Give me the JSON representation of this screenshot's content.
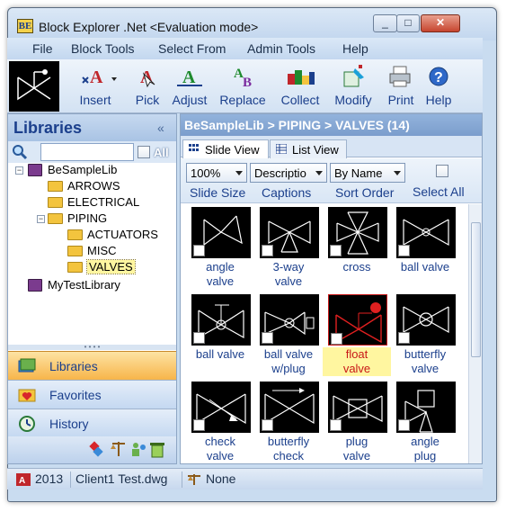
{
  "window": {
    "title": "Block Explorer .Net <Evaluation mode>",
    "app_icon_text": "BE"
  },
  "menu": [
    "File",
    "Block Tools",
    "Select From",
    "Admin Tools",
    "Help"
  ],
  "toolbar": {
    "tools": [
      {
        "label": "Insert",
        "icon": "insert-icon"
      },
      {
        "label": "Pick",
        "icon": "pick-icon"
      },
      {
        "label": "Adjust",
        "icon": "adjust-icon"
      },
      {
        "label": "Replace",
        "icon": "replace-icon"
      },
      {
        "label": "Collect",
        "icon": "collect-icon"
      },
      {
        "label": "Modify",
        "icon": "modify-icon"
      },
      {
        "label": "Print",
        "icon": "printer-icon"
      },
      {
        "label": "Help",
        "icon": "help-icon"
      }
    ]
  },
  "libraries": {
    "title": "Libraries",
    "collapse_glyph": "«",
    "search_all_label": "All",
    "tree": [
      {
        "label": "BeSampleLib",
        "type": "library",
        "level": 0,
        "expander": "⊟"
      },
      {
        "label": "ARROWS",
        "type": "folder",
        "level": 1
      },
      {
        "label": "ELECTRICAL",
        "type": "folder",
        "level": 1
      },
      {
        "label": "PIPING",
        "type": "folder",
        "level": 1,
        "expander": "⊟"
      },
      {
        "label": "ACTUATORS",
        "type": "folder",
        "level": 2
      },
      {
        "label": "MISC",
        "type": "folder",
        "level": 2
      },
      {
        "label": "VALVES",
        "type": "folder",
        "level": 2,
        "selected": true
      },
      {
        "label": "MyTestLibrary",
        "type": "library",
        "level": 0
      }
    ],
    "nav": [
      {
        "label": "Libraries",
        "icon": "books-icon",
        "active": true
      },
      {
        "label": "Favorites",
        "icon": "heart-folder-icon",
        "active": false
      },
      {
        "label": "History",
        "icon": "clock-icon",
        "active": false
      }
    ]
  },
  "content": {
    "path": "BeSampleLib > PIPING > VALVES (14)",
    "tabs": [
      {
        "label": "Slide View",
        "active": true
      },
      {
        "label": "List View",
        "active": false
      }
    ],
    "controls": {
      "size_value": "100%",
      "caption_value": "Descriptio",
      "sort_value": "By Name",
      "size_caption": "Slide Size",
      "caption_caption": "Captions",
      "sort_caption": "Sort Order",
      "select_all": "Select All"
    },
    "slides": [
      {
        "line1": "angle",
        "line2": "valve",
        "symbol": "angle"
      },
      {
        "line1": "3-way",
        "line2": "valve",
        "symbol": "threeway"
      },
      {
        "line1": "cross",
        "line2": "",
        "symbol": "cross"
      },
      {
        "line1": "ball valve",
        "line2": "",
        "symbol": "ball"
      },
      {
        "line1": "ball valve",
        "line2": "",
        "symbol": "ballstem"
      },
      {
        "line1": "ball valve",
        "line2": "w/plug",
        "symbol": "ballplug"
      },
      {
        "line1": "float",
        "line2": "valve",
        "symbol": "float",
        "selected": true
      },
      {
        "line1": "butterfly",
        "line2": "valve",
        "symbol": "butterfly"
      },
      {
        "line1": "check",
        "line2": "valve",
        "symbol": "check"
      },
      {
        "line1": "butterfly",
        "line2": "check",
        "symbol": "bfcheck"
      },
      {
        "line1": "plug",
        "line2": "valve",
        "symbol": "plug"
      },
      {
        "line1": "angle",
        "line2": "plug",
        "symbol": "angleplug"
      }
    ]
  },
  "status": {
    "version": "2013",
    "file": "Client1 Test.dwg",
    "scale": "None"
  }
}
